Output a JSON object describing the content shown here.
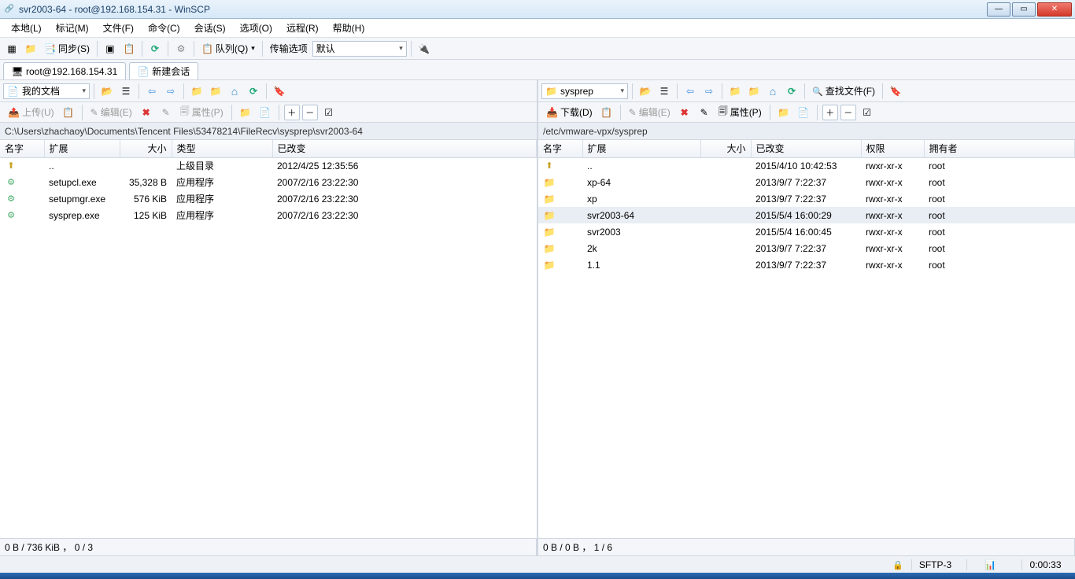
{
  "window": {
    "title": "svr2003-64 - root@192.168.154.31 - WinSCP"
  },
  "menu": [
    "本地(L)",
    "标记(M)",
    "文件(F)",
    "命令(C)",
    "会话(S)",
    "选项(O)",
    "远程(R)",
    "帮助(H)"
  ],
  "main_toolbar": {
    "sync": "同步(S)",
    "queue": "队列(Q)",
    "transfer_label": "传输选项",
    "transfer_value": "默认"
  },
  "tabs": {
    "active": "root@192.168.154.31",
    "new": "新建会话"
  },
  "left": {
    "folder": "我的文档",
    "upload": "上传(U)",
    "edit": "编辑(E)",
    "props": "属性(P)",
    "path": "C:\\Users\\zhachaoy\\Documents\\Tencent Files\\53478214\\FileRecv\\sysprep\\svr2003-64",
    "cols": [
      "名字",
      "扩展",
      "大小",
      "类型",
      "已改变"
    ],
    "rows": [
      {
        "name": "..",
        "size": "",
        "type": "上级目录",
        "changed": "2012/4/25  12:35:56",
        "icon": "up"
      },
      {
        "name": "setupcl.exe",
        "size": "35,328 B",
        "type": "应用程序",
        "changed": "2007/2/16  23:22:30",
        "icon": "exe"
      },
      {
        "name": "setupmgr.exe",
        "size": "576 KiB",
        "type": "应用程序",
        "changed": "2007/2/16  23:22:30",
        "icon": "exe"
      },
      {
        "name": "sysprep.exe",
        "size": "125 KiB",
        "type": "应用程序",
        "changed": "2007/2/16  23:22:30",
        "icon": "exe"
      }
    ],
    "status": "0 B / 736 KiB ， 0 / 3"
  },
  "right": {
    "folder": "sysprep",
    "download": "下载(D)",
    "edit": "编辑(E)",
    "props": "属性(P)",
    "search": "查找文件(F)",
    "path": "/etc/vmware-vpx/sysprep",
    "cols": [
      "名字",
      "扩展",
      "大小",
      "已改变",
      "权限",
      "拥有者"
    ],
    "rows": [
      {
        "name": "..",
        "size": "",
        "changed": "2015/4/10 10:42:53",
        "perm": "rwxr-xr-x",
        "owner": "root",
        "icon": "up"
      },
      {
        "name": "xp-64",
        "size": "",
        "changed": "2013/9/7 7:22:37",
        "perm": "rwxr-xr-x",
        "owner": "root",
        "icon": "folder"
      },
      {
        "name": "xp",
        "size": "",
        "changed": "2013/9/7 7:22:37",
        "perm": "rwxr-xr-x",
        "owner": "root",
        "icon": "folder"
      },
      {
        "name": "svr2003-64",
        "size": "",
        "changed": "2015/5/4 16:00:29",
        "perm": "rwxr-xr-x",
        "owner": "root",
        "icon": "folder",
        "selected": true
      },
      {
        "name": "svr2003",
        "size": "",
        "changed": "2015/5/4 16:00:45",
        "perm": "rwxr-xr-x",
        "owner": "root",
        "icon": "folder"
      },
      {
        "name": "2k",
        "size": "",
        "changed": "2013/9/7 7:22:37",
        "perm": "rwxr-xr-x",
        "owner": "root",
        "icon": "folder"
      },
      {
        "name": "1.1",
        "size": "",
        "changed": "2013/9/7 7:22:37",
        "perm": "rwxr-xr-x",
        "owner": "root",
        "icon": "folder"
      }
    ],
    "status": "0 B / 0 B ， 1 / 6"
  },
  "bottom": {
    "proto": "SFTP-3",
    "time": "0:00:33"
  }
}
